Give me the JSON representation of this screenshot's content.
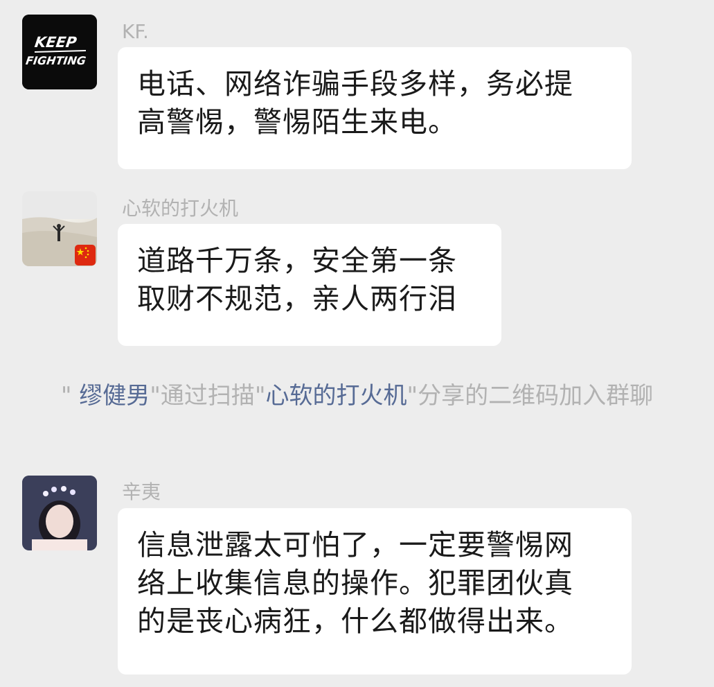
{
  "chat": {
    "messages": [
      {
        "sender": "KF.",
        "avatar": "keep-fighting-avatar",
        "avatar_text_top": "KEEP",
        "avatar_text_bottom": "FIGHTING",
        "lines": [
          "电话、网络诈骗手段多样，务必提",
          "高警惕，警惕陌生来电。"
        ]
      },
      {
        "sender": "心软的打火机",
        "avatar": "beach-photo-avatar",
        "badge": "china-flag-icon",
        "lines": [
          "道路千万条，安全第一条",
          "取财不规范，亲人两行泪"
        ]
      },
      {
        "sender": "辛夷",
        "avatar": "girl-photo-avatar",
        "lines": [
          "信息泄露太可怕了，一定要警惕网",
          "络上收集信息的操作。犯罪团伙真",
          "的是丧心病狂，什么都做得出来。"
        ]
      }
    ],
    "system_notice": {
      "quote_open": "\" ",
      "member": "缪健男",
      "mid": "\"通过扫描\"",
      "sharer": "心软的打火机",
      "tail": "\"分享的二维码加入群聊"
    }
  },
  "colors": {
    "background": "#ededed",
    "bubble": "#ffffff",
    "link": "#576b95",
    "muted": "#b2b2b2"
  }
}
